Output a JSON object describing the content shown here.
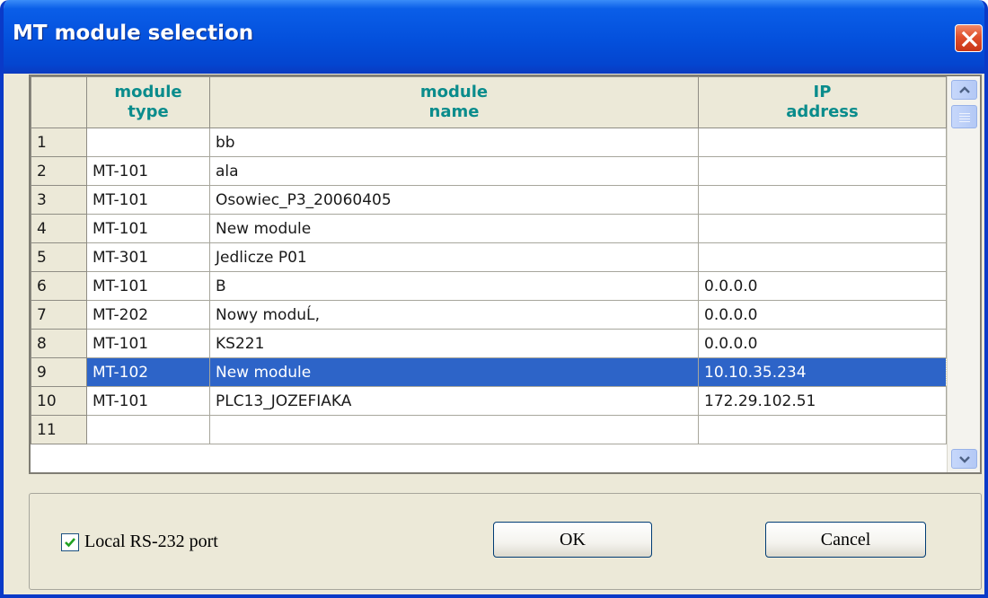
{
  "window": {
    "title": "MT module selection"
  },
  "grid": {
    "columns": [
      {
        "line1": "",
        "line2": ""
      },
      {
        "line1": "module",
        "line2": "type"
      },
      {
        "line1": "module",
        "line2": "name"
      },
      {
        "line1": "IP",
        "line2": "address"
      }
    ],
    "rows": [
      {
        "num": "1",
        "type": "",
        "name": "bb",
        "ip": ""
      },
      {
        "num": "2",
        "type": "MT-101",
        "name": "ala",
        "ip": ""
      },
      {
        "num": "3",
        "type": "MT-101",
        "name": "Osowiec_P3_20060405",
        "ip": ""
      },
      {
        "num": "4",
        "type": "MT-101",
        "name": "New module",
        "ip": ""
      },
      {
        "num": "5",
        "type": "MT-301",
        "name": "Jedlicze P01",
        "ip": ""
      },
      {
        "num": "6",
        "type": "MT-101",
        "name": "B",
        "ip": "0.0.0.0"
      },
      {
        "num": "7",
        "type": "MT-202",
        "name": "Nowy moduĹ‚",
        "ip": "0.0.0.0"
      },
      {
        "num": "8",
        "type": "MT-101",
        "name": "KS221",
        "ip": "0.0.0.0"
      },
      {
        "num": "9",
        "type": "MT-102",
        "name": "New module",
        "ip": "10.10.35.234"
      },
      {
        "num": "10",
        "type": "MT-101",
        "name": "PLC13_JOZEFIAKA",
        "ip": "172.29.102.51"
      },
      {
        "num": "11",
        "type": "",
        "name": "",
        "ip": ""
      }
    ],
    "selected_row": "9"
  },
  "options": {
    "local_rs232_label": "Local RS-232 port",
    "local_rs232_checked": true
  },
  "buttons": {
    "ok_label": "OK",
    "cancel_label": "Cancel"
  },
  "colors": {
    "title_bar": "#0450dc",
    "header_text": "#0a8c8c",
    "selection": "#2d64c8",
    "close_button": "#e0502c"
  },
  "icons": {
    "close": "close-icon",
    "scroll_up": "chevron-up-icon",
    "scroll_down": "chevron-down-icon",
    "checkbox": "check-icon"
  }
}
